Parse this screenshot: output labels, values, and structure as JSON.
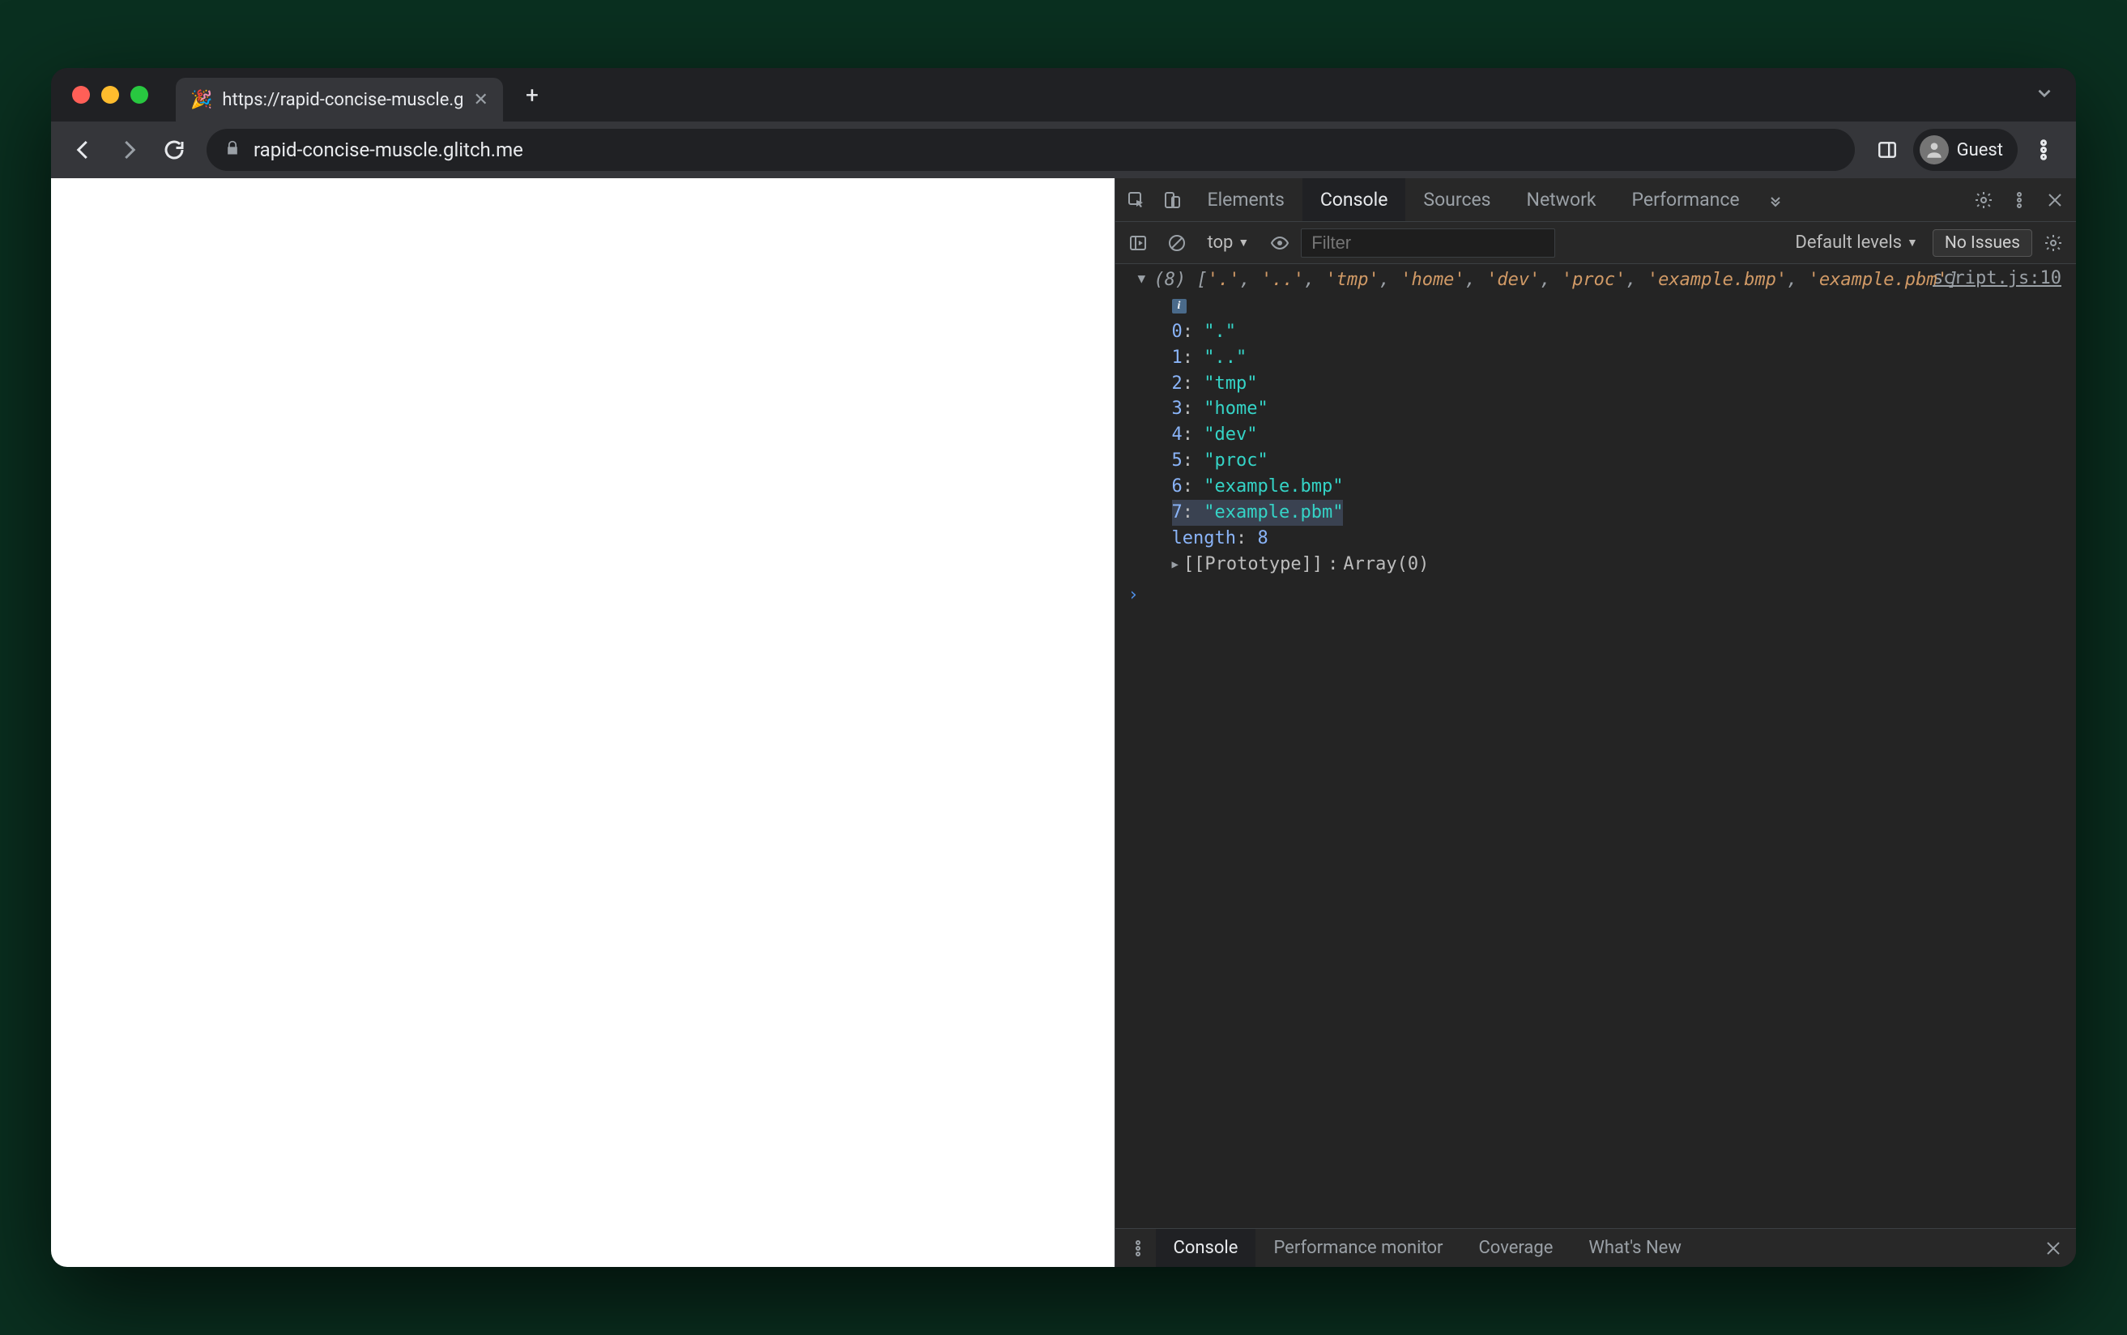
{
  "tabstrip": {
    "favicon": "🎉",
    "title": "https://rapid-concise-muscle.g"
  },
  "toolbar": {
    "url": "rapid-concise-muscle.glitch.me",
    "profile_label": "Guest"
  },
  "devtools": {
    "tabs": [
      "Elements",
      "Console",
      "Sources",
      "Network",
      "Performance"
    ],
    "active_tab": "Console",
    "console_bar": {
      "context": "top",
      "filter_placeholder": "Filter",
      "levels": "Default levels",
      "issues": "No Issues"
    },
    "source_link": "script.js:10",
    "log": {
      "count": "(8)",
      "preview_items": [
        ".",
        "..",
        "tmp",
        "home",
        "dev",
        "proc",
        "example.bmp",
        "example.pbm"
      ],
      "items": [
        {
          "idx": "0",
          "val": "\".\""
        },
        {
          "idx": "1",
          "val": "\"..\""
        },
        {
          "idx": "2",
          "val": "\"tmp\""
        },
        {
          "idx": "3",
          "val": "\"home\""
        },
        {
          "idx": "4",
          "val": "\"dev\""
        },
        {
          "idx": "5",
          "val": "\"proc\""
        },
        {
          "idx": "6",
          "val": "\"example.bmp\""
        },
        {
          "idx": "7",
          "val": "\"example.pbm\"",
          "highlight": true
        }
      ],
      "length_label": "length",
      "length_value": "8",
      "proto_label": "[[Prototype]]",
      "proto_value": "Array(0)"
    },
    "drawer": {
      "tabs": [
        "Console",
        "Performance monitor",
        "Coverage",
        "What's New"
      ],
      "active": "Console"
    }
  }
}
